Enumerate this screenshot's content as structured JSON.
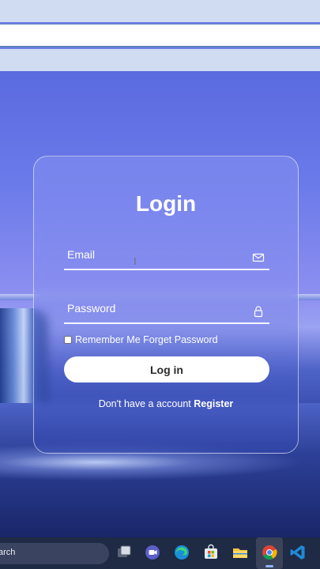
{
  "login_form": {
    "title": "Login",
    "email_label": "Email",
    "password_label": "Password",
    "remember_text": "Remember Me Forget Password",
    "login_button": "Log in",
    "no_account_text": "Don't have a account",
    "register_link": "Register"
  },
  "taskbar": {
    "search_text": "arch",
    "apps": [
      "task-view",
      "teams",
      "edge",
      "store",
      "file-explorer",
      "chrome",
      "vscode"
    ],
    "active_app": "chrome"
  },
  "icons": {
    "email_field": "mail-icon",
    "password_field": "lock-icon"
  }
}
